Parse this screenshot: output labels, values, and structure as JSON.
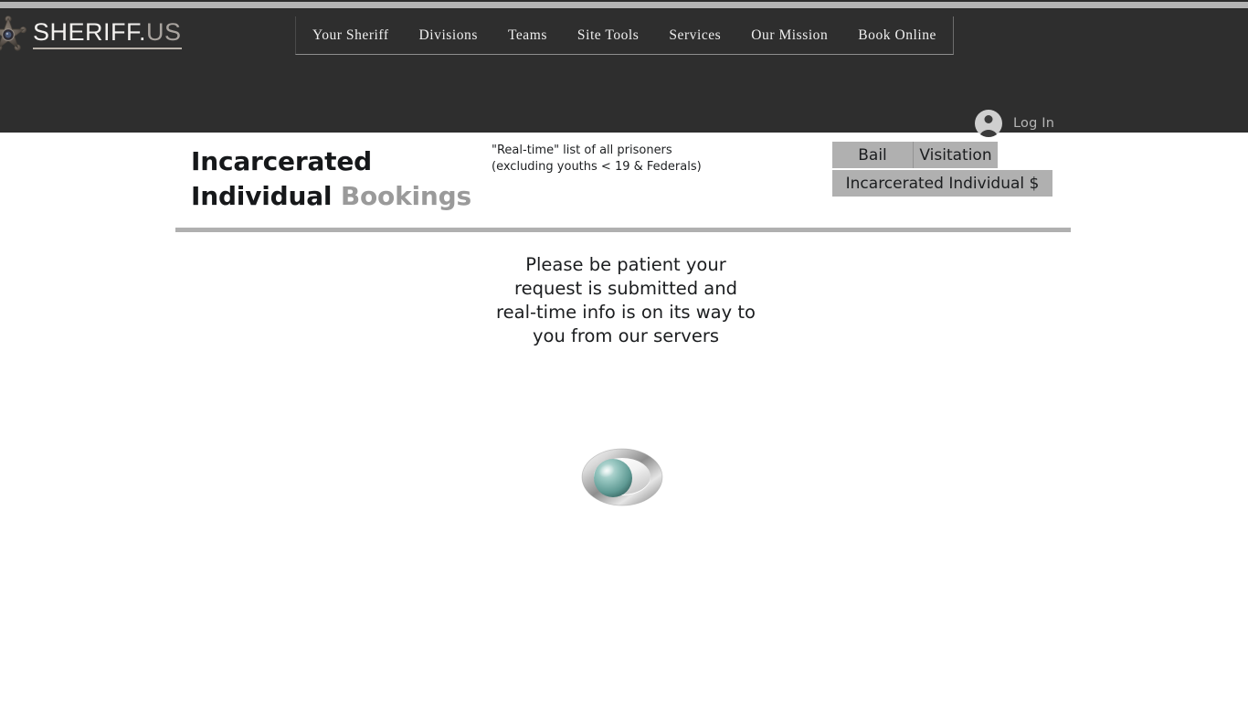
{
  "browser": {
    "chrome_band_color": "#b3b3b3"
  },
  "header": {
    "background_color": "#2e2e2e",
    "brand": {
      "icon": "sheriff-star-badge-icon",
      "text_primary": "SHERIFF.",
      "text_secondary": "US"
    },
    "nav": [
      {
        "label": "Your Sheriff"
      },
      {
        "label": "Divisions"
      },
      {
        "label": "Teams"
      },
      {
        "label": "Site Tools"
      },
      {
        "label": "Services"
      },
      {
        "label": "Our Mission"
      },
      {
        "label": "Book Online"
      }
    ],
    "login": {
      "icon": "user-avatar-icon",
      "label": "Log In"
    }
  },
  "main": {
    "title": {
      "line1": "Incarcerated",
      "line2_dark": "Individual ",
      "line2_grey": "Bookings"
    },
    "subtitle": {
      "line1": "\"Real-time\" list of all prisoners",
      "line2": "(excluding youths <  19 & Federals)"
    },
    "action_buttons": {
      "bail": "Bail",
      "visitation": "Visitation",
      "incarcerated_cost": "Incarcerated Individual $",
      "background_color": "#b0b0b0"
    },
    "divider_color": "#b0b0b0",
    "loading": {
      "message": "Please be patient your request is submitted and real-time info is on its way to you from our servers",
      "spinner_icon": "loading-orbit-spinner-icon",
      "spinner_ring_color": "#c9c9c9",
      "spinner_ball_color": "#7fb3ae"
    }
  }
}
